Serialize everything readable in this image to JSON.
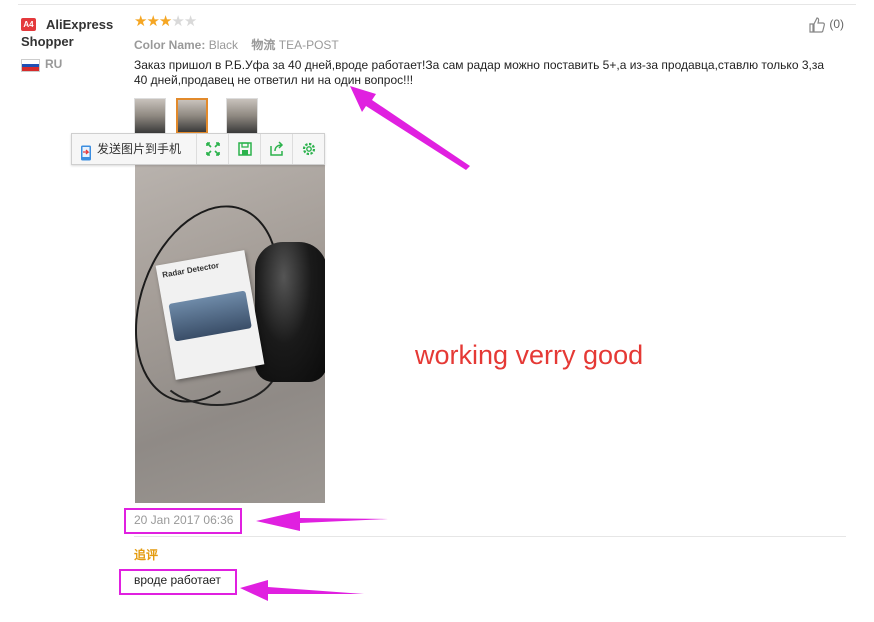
{
  "reviewer": {
    "badge": "A4",
    "name": "AliExpress Shopper",
    "country": "RU",
    "flag_colors": [
      "#ffffff",
      "#1f4fb4",
      "#d62b2b"
    ]
  },
  "review": {
    "rating": 3,
    "max_rating": 5,
    "star_color_on": "#f5a623",
    "star_color_off": "#d9d9d9",
    "color_name_label": "Color Name:",
    "color_name_value": "Black",
    "shipping_label": "物流",
    "shipping_value": "TEA-POST",
    "text": "Заказ пришол в Р.Б.Уфа за 40 дней,вроде работает!За сам радар можно поставить 5+,а из-за продавца,ставлю только 3,за 40 дней,продавец не ответил ни на один вопрос!!!",
    "likes": "(0)",
    "date": "20 Jan 2017 06:36",
    "thumbnail_count": 3,
    "active_thumbnail": 2
  },
  "photo_toolbar": {
    "send_to_phone_label": "发送图片到手机",
    "buttons": [
      "fullscreen-icon",
      "save-icon",
      "share-icon",
      "settings-icon"
    ],
    "icon_color": "#2bb24c"
  },
  "photo": {
    "box_label": "Radar Detector"
  },
  "annotations": {
    "caption": "working verry good",
    "caption_color": "#e53935",
    "highlight_color": "#e020e0"
  },
  "followup": {
    "label": "追评",
    "text": "вроде работает"
  }
}
